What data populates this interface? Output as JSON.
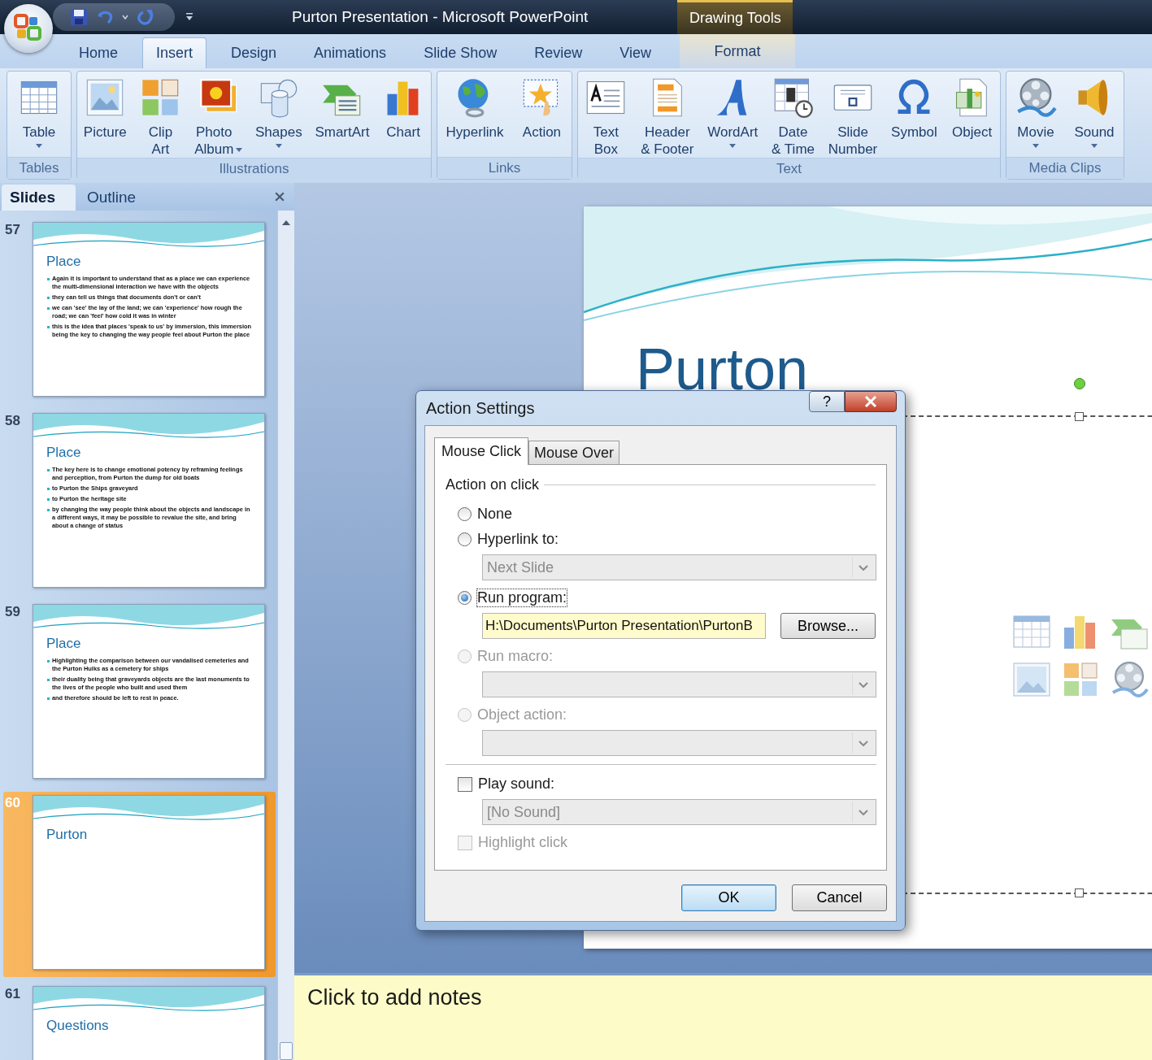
{
  "window": {
    "title": "Purton Presentation - Microsoft PowerPoint",
    "contextual_group": "Drawing Tools"
  },
  "tabs": [
    {
      "label": "Home",
      "selected": false,
      "contextual": false
    },
    {
      "label": "Insert",
      "selected": true,
      "contextual": false
    },
    {
      "label": "Design",
      "selected": false,
      "contextual": false
    },
    {
      "label": "Animations",
      "selected": false,
      "contextual": false
    },
    {
      "label": "Slide Show",
      "selected": false,
      "contextual": false
    },
    {
      "label": "Review",
      "selected": false,
      "contextual": false
    },
    {
      "label": "View",
      "selected": false,
      "contextual": false
    },
    {
      "label": "Format",
      "selected": false,
      "contextual": true
    }
  ],
  "ribbon": [
    {
      "label": "Tables",
      "buttons": [
        {
          "lines": [
            "Table"
          ],
          "dropdown": true
        }
      ]
    },
    {
      "label": "Illustrations",
      "buttons": [
        {
          "lines": [
            "Picture"
          ],
          "dropdown": false
        },
        {
          "lines": [
            "Clip",
            "Art"
          ],
          "dropdown": false
        },
        {
          "lines": [
            "Photo",
            "Album"
          ],
          "dropdown": true
        },
        {
          "lines": [
            "Shapes"
          ],
          "dropdown": true
        },
        {
          "lines": [
            "SmartArt"
          ],
          "dropdown": false
        },
        {
          "lines": [
            "Chart"
          ],
          "dropdown": false
        }
      ]
    },
    {
      "label": "Links",
      "buttons": [
        {
          "lines": [
            "Hyperlink"
          ],
          "dropdown": false
        },
        {
          "lines": [
            "Action"
          ],
          "dropdown": false
        }
      ]
    },
    {
      "label": "Text",
      "buttons": [
        {
          "lines": [
            "Text",
            "Box"
          ],
          "dropdown": false
        },
        {
          "lines": [
            "Header",
            "& Footer"
          ],
          "dropdown": false
        },
        {
          "lines": [
            "WordArt"
          ],
          "dropdown": true
        },
        {
          "lines": [
            "Date",
            "& Time"
          ],
          "dropdown": false
        },
        {
          "lines": [
            "Slide",
            "Number"
          ],
          "dropdown": false
        },
        {
          "lines": [
            "Symbol"
          ],
          "dropdown": false
        },
        {
          "lines": [
            "Object"
          ],
          "dropdown": false
        }
      ]
    },
    {
      "label": "Media Clips",
      "buttons": [
        {
          "lines": [
            "Movie"
          ],
          "dropdown": true
        },
        {
          "lines": [
            "Sound"
          ],
          "dropdown": true
        }
      ]
    }
  ],
  "pane_tabs": [
    {
      "label": "Slides",
      "selected": true
    },
    {
      "label": "Outline",
      "selected": false
    }
  ],
  "slides": [
    {
      "number": "57",
      "title": "Place",
      "selected": false,
      "bullets": [
        "Again it is important to understand that as a place we can experience the multi-dimensional interaction we have with the objects",
        "they can tell us things that documents don't or can't",
        "we can 'see' the lay of the land; we can 'experience' how rough the road; we can 'feel' how cold it was in winter",
        "this is the idea that places 'speak to us' by immersion, this immersion being the key to changing the way people feel about Purton the place"
      ]
    },
    {
      "number": "58",
      "title": "Place",
      "selected": false,
      "bullets": [
        "The key here is to change emotional potency by reframing feelings and perception, from Purton the dump for old boats",
        "to Purton the Ships graveyard",
        "to Purton the heritage site",
        "by changing the way people think about the objects and landscape in a different ways, it may be possible to revalue the site, and bring about a change of status"
      ]
    },
    {
      "number": "59",
      "title": "Place",
      "selected": false,
      "bullets": [
        "Highlighting the comparison between our vandalised cemeteries and the Purton Hulks as a cemetery for ships",
        "their duality being that graveyards objects are the last monuments to the lives of the people who built and used them",
        "and therefore should be left to rest in peace."
      ]
    },
    {
      "number": "60",
      "title": "Purton",
      "selected": true
    },
    {
      "number": "61",
      "title": "Questions",
      "selected": false
    }
  ],
  "slide_editor": {
    "title": "Purton"
  },
  "notes": {
    "placeholder": "Click to add notes"
  },
  "dialog": {
    "title": "Action Settings",
    "help": "?",
    "tabs": [
      {
        "label": "Mouse Click",
        "selected": true
      },
      {
        "label": "Mouse Over",
        "selected": false
      }
    ],
    "group_label": "Action on click",
    "options": [
      {
        "label": "None",
        "selected": false,
        "disabled": false
      },
      {
        "label": "Hyperlink to:",
        "selected": false,
        "disabled": false,
        "dropdown": {
          "value": "Next Slide",
          "disabled": true
        }
      },
      {
        "label": "Run program:",
        "selected": true,
        "disabled": false,
        "field": {
          "value": "H:\\Documents\\Purton Presentation\\PurtonB"
        },
        "button": "Browse..."
      },
      {
        "label": "Run macro:",
        "selected": false,
        "disabled": true,
        "dropdown": {
          "disabled": true
        }
      },
      {
        "label": "Object action:",
        "selected": false,
        "disabled": true,
        "dropdown": {
          "disabled": true
        }
      }
    ],
    "play_sound": {
      "label": "Play sound:",
      "checked": false,
      "disabled": false,
      "dropdown": {
        "value": "[No Sound]",
        "disabled": true
      }
    },
    "highlight_click": {
      "label": "Highlight click",
      "checked": false,
      "disabled": true
    },
    "buttons": [
      {
        "label": "OK",
        "default": true
      },
      {
        "label": "Cancel",
        "default": false
      }
    ]
  }
}
